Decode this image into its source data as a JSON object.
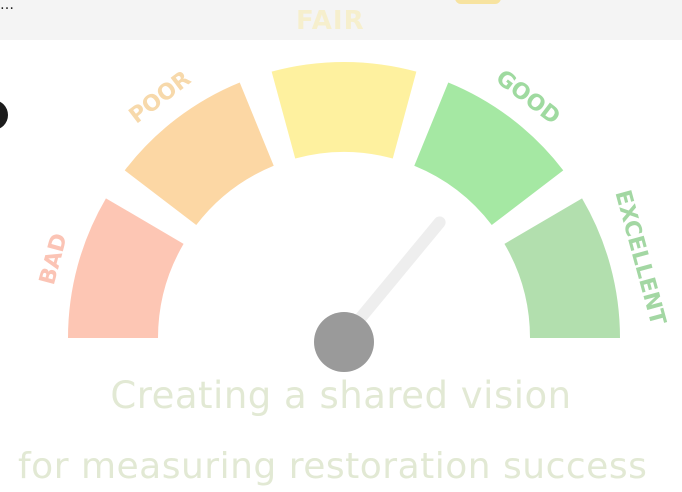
{
  "header": {
    "partial_label": "FAIR"
  },
  "gauge": {
    "segments": [
      {
        "label": "BAD",
        "color": "#fdc6b4",
        "text_color": "#fbc4b5"
      },
      {
        "label": "POOR",
        "color": "#fcd7a4",
        "text_color": "#f7d9ab"
      },
      {
        "label": "FAIR",
        "color": "#fef19f",
        "text_color": "#f6efcd"
      },
      {
        "label": "GOOD",
        "color": "#a5e8a3",
        "text_color": "#9fdaa0"
      },
      {
        "label": "EXCELLENT",
        "color": "#b2dfae",
        "text_color": "#a3d7a3"
      }
    ],
    "needle_level": 0.72,
    "hub_color": "#9a9a9a"
  },
  "tagline": {
    "line1": "Creating a shared vision",
    "line2": "for measuring restoration success"
  }
}
